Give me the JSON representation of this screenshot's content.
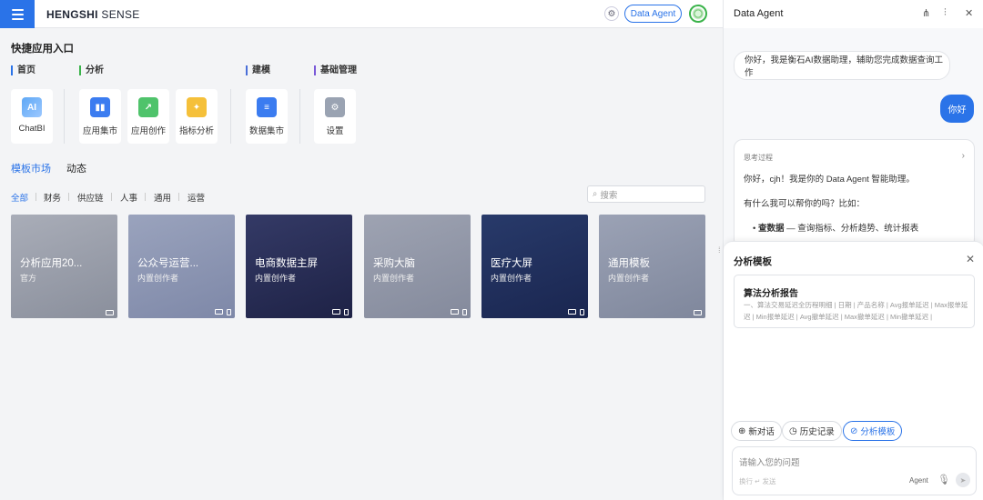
{
  "header": {
    "logo_bold": "HENGSHI",
    "logo_thin": " SENSE",
    "agent_button": "Data Agent"
  },
  "quick": {
    "title": "快捷应用入口",
    "groups": [
      "首页",
      "分析",
      "建模",
      "基础管理"
    ],
    "cards": [
      {
        "label": "ChatBI",
        "icon": "ai-icon",
        "badge": "AI"
      },
      {
        "label": "应用集市",
        "icon": "app-market-icon",
        "badge": "▮▮"
      },
      {
        "label": "应用创作",
        "icon": "app-create-icon",
        "badge": "↗"
      },
      {
        "label": "指标分析",
        "icon": "metric-icon",
        "badge": "✦"
      },
      {
        "label": "数据集市",
        "icon": "data-market-icon",
        "badge": "≡"
      },
      {
        "label": "设置",
        "icon": "settings-icon",
        "badge": "⚙"
      }
    ]
  },
  "tabs": [
    "模板市场",
    "动态"
  ],
  "filters": [
    "全部",
    "财务",
    "供应链",
    "人事",
    "通用",
    "运营"
  ],
  "search_placeholder": "搜索",
  "templates": [
    {
      "name": "分析应用20...",
      "author": "官方"
    },
    {
      "name": "公众号运营...",
      "author": "内置创作者"
    },
    {
      "name": "电商数据主屏",
      "author": "内置创作者"
    },
    {
      "name": "采购大脑",
      "author": "内置创作者"
    },
    {
      "name": "医疗大屏",
      "author": "内置创作者"
    },
    {
      "name": "通用模板",
      "author": "内置创作者"
    }
  ],
  "agent": {
    "title": "Data Agent",
    "greeting": "你好，我是衡石AI数据助理，辅助您完成数据查询工作",
    "user_msg": "你好",
    "think_label": "思考过程",
    "reply_line1": "你好，cjh！我是你的 Data Agent 智能助理。",
    "reply_line2": "有什么我可以帮你的吗？比如：",
    "reply_bullet_bold": "查数据",
    "reply_bullet_rest": " — 查询指标、分析趋势、统计报表",
    "panel_title": "分析模板",
    "template_title": "算法分析报告",
    "template_desc": "一、算法交易延迟全历程明细 | 日期 | 产品名称 | Avg报单延迟 | Max报单延迟 | Min报单延迟 | Avg撤单延迟 | Max撤单延迟 | Min撤单延迟 |",
    "chips": [
      "新对话",
      "历史记录",
      "分析模板"
    ],
    "input_placeholder": "请输入您的问题",
    "input_hint": "换行 ↵ 发送",
    "agent_label": "Agent"
  }
}
